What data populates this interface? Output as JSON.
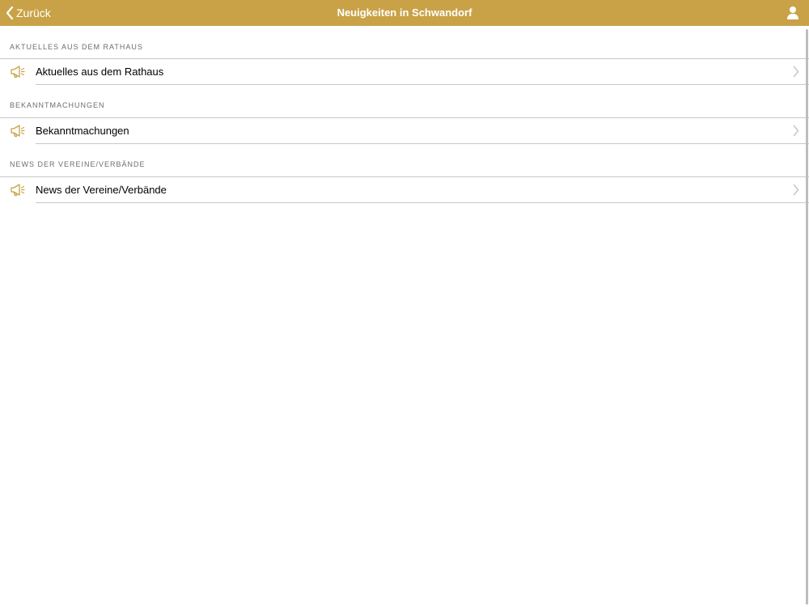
{
  "nav": {
    "back_label": "Zurück",
    "title": "Neuigkeiten in Schwandorf",
    "accent_color": "#c9a247"
  },
  "sections": [
    {
      "header": "AKTUELLES AUS DEM RATHAUS",
      "item_label": "Aktuelles aus dem Rathaus",
      "icon": "megaphone-icon"
    },
    {
      "header": "BEKANNTMACHUNGEN",
      "item_label": "Bekanntmachungen",
      "icon": "megaphone-icon"
    },
    {
      "header": "NEWS DER VEREINE/VERBÄNDE",
      "item_label": "News der Vereine/Verbände",
      "icon": "megaphone-icon"
    }
  ]
}
